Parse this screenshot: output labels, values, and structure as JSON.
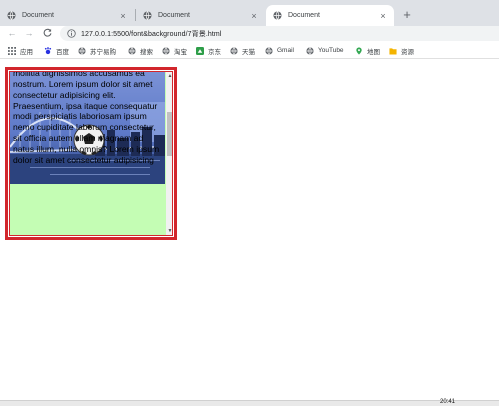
{
  "tabs": [
    {
      "title": "Document",
      "active": false,
      "close_glyph": "×"
    },
    {
      "title": "Document",
      "active": false,
      "close_glyph": "×"
    },
    {
      "title": "Document",
      "active": true,
      "close_glyph": "×"
    }
  ],
  "new_tab_glyph": "+",
  "toolbar": {
    "back_glyph": "←",
    "forward_glyph": "→",
    "reload_glyph": "C",
    "url": "127.0.0.1:5500/font&background/7背景.html"
  },
  "bookmarks": [
    {
      "label": "应用",
      "icon": "apps-grid-icon"
    },
    {
      "label": "百度",
      "icon": "baidu-icon"
    },
    {
      "label": "苏宁易购",
      "icon": "globe-icon"
    },
    {
      "label": "搜索",
      "icon": "globe-icon"
    },
    {
      "label": "淘宝",
      "icon": "globe-icon"
    },
    {
      "label": "京东",
      "icon": "jd-icon"
    },
    {
      "label": "天猫",
      "icon": "globe-icon"
    },
    {
      "label": "Gmail",
      "icon": "globe-icon"
    },
    {
      "label": "YouTube",
      "icon": "globe-icon"
    },
    {
      "label": "地图",
      "icon": "maps-icon"
    },
    {
      "label": "资源",
      "icon": "folder-icon"
    }
  ],
  "page": {
    "text": "mollitia dignissimos accusamus ea nostrum. Lorem ipsum dolor sit amet consectetur adipisicing elit. Praesentium, ipsa itaque consequatur modi perspiciatis laboriosam ipsum nemo cupiditate laborum consectetur, sit officia autem ullam magnam ad natus illum, nulla omnis? Lorem ipsum dolor sit amet consectetur adipisicing",
    "scroll_up_glyph": "▲",
    "scroll_down_glyph": "▼"
  },
  "colors": {
    "border": "#d2262c",
    "box_background": "#c4fdb4"
  },
  "taskbar": {
    "clock": "20:41"
  }
}
